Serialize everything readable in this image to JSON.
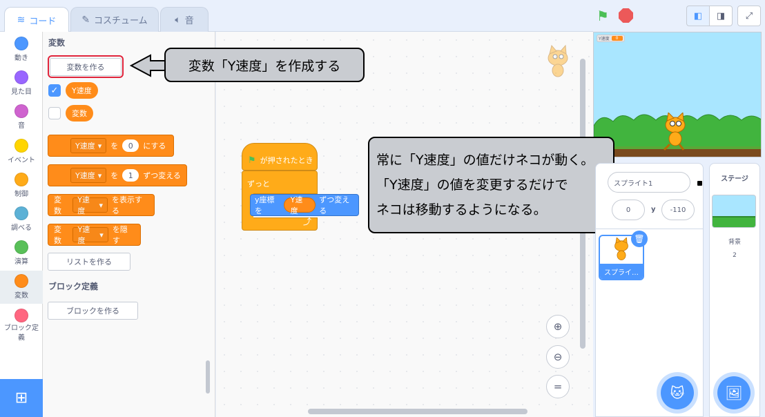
{
  "tabs": {
    "code": "コード",
    "costume": "コスチューム",
    "sound": "音"
  },
  "categories": [
    {
      "label": "動き",
      "color": "#4c97ff"
    },
    {
      "label": "見た目",
      "color": "#9966ff"
    },
    {
      "label": "音",
      "color": "#cf63cf"
    },
    {
      "label": "イベント",
      "color": "#ffd500"
    },
    {
      "label": "制御",
      "color": "#ffab19"
    },
    {
      "label": "調べる",
      "color": "#5cb1d6"
    },
    {
      "label": "演算",
      "color": "#59c059"
    },
    {
      "label": "変数",
      "color": "#ff8c1a"
    },
    {
      "label": "ブロック定義",
      "color": "#ff6680"
    }
  ],
  "palette": {
    "heading": "変数",
    "make_variable": "変数を作る",
    "variables": [
      {
        "name": "Y速度",
        "checked": true
      },
      {
        "name": "変数",
        "checked": false
      }
    ],
    "blocks": {
      "set": {
        "var": "Y速度",
        "to": "を",
        "value": "0",
        "suffix": "にする"
      },
      "change": {
        "var": "Y速度",
        "to": "を",
        "value": "1",
        "suffix": "ずつ変える"
      },
      "show": {
        "prefix": "変数",
        "var": "Y速度",
        "suffix": "を表示する"
      },
      "hide": {
        "prefix": "変数",
        "var": "Y速度",
        "suffix": "を隠す"
      }
    },
    "make_list": "リストを作る",
    "block_def_heading": "ブロック定義",
    "make_block": "ブロックを作る"
  },
  "script": {
    "hat": "が押されたとき",
    "forever": "ずっと",
    "change_y": {
      "label": "y座標を",
      "var": "Y速度",
      "suffix": "ずつ変える"
    }
  },
  "callouts": {
    "create_var": "変数「Y速度」を作成する",
    "explain_line1": "常に「Y速度」の値だけネコが動く。",
    "explain_line2": "「Y速度」の値を変更するだけで",
    "explain_line3": "ネコは移動するようになる。"
  },
  "stage": {
    "monitor_label": "Y速度",
    "monitor_value": "0"
  },
  "sprite_info": {
    "name": "スプライト1",
    "x": "0",
    "y_label": "y",
    "y": "-110",
    "thumb_label": "スプライ…"
  },
  "stage_pane": {
    "title": "ステージ",
    "backdrop_label": "背景",
    "backdrop_count": "2"
  },
  "zoom": {
    "reset_label": "="
  },
  "colors": {
    "accent": "#4c97ff",
    "variables": "#ff8c1a",
    "control": "#ffab19",
    "highlight": "#e0243b"
  }
}
